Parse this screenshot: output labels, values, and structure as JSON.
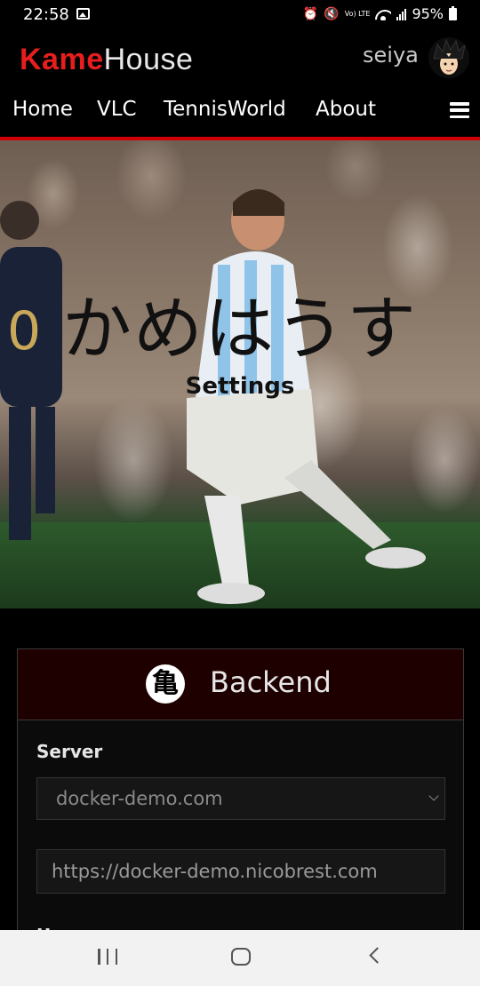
{
  "status_bar": {
    "time": "22:58",
    "battery": "95%",
    "volte": "Vo) LTE",
    "icons": [
      "image-icon",
      "alarm-icon",
      "mute-icon",
      "volte-icon",
      "wifi-icon",
      "signal-icon",
      "battery-icon"
    ]
  },
  "header": {
    "logo_part1": "Kame",
    "logo_part2": "House",
    "username": "seiya",
    "nav": [
      "Home",
      "VLC",
      "TennisWorld",
      "About"
    ],
    "accent_color": "#d00000"
  },
  "hero": {
    "title": "かめはうす",
    "subtitle": "Settings"
  },
  "backend": {
    "title": "Backend",
    "icon_glyph": "亀",
    "server_label": "Server",
    "server_selected": "docker-demo.com",
    "url_value": "https://docker-demo.nicobrest.com",
    "next_label": "U"
  },
  "colors": {
    "card_header_bg": "#1f0000",
    "logo_red": "#e81e1e"
  }
}
